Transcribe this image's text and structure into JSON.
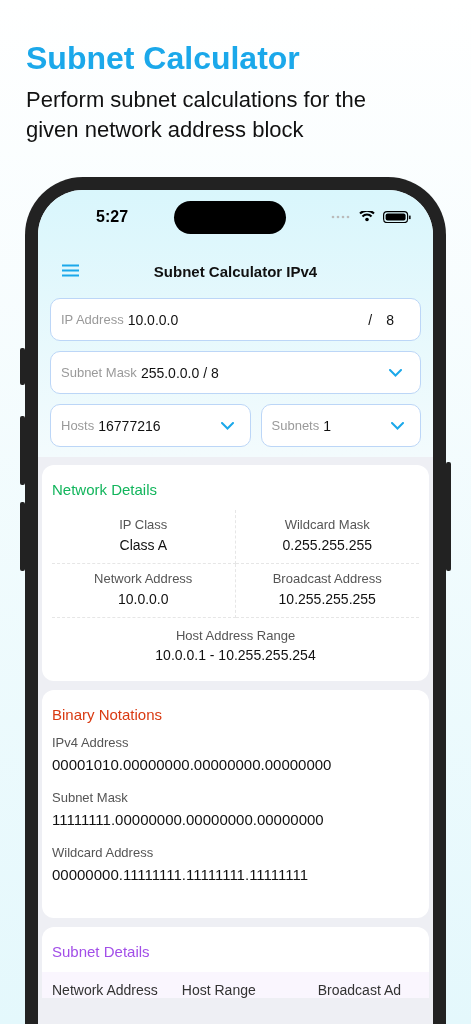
{
  "header": {
    "title": "Subnet Calculator",
    "subtitle": "Perform subnet calculations for the given network address block"
  },
  "status_bar": {
    "time": "5:27"
  },
  "nav": {
    "title": "Subnet Calculator IPv4"
  },
  "ip_field": {
    "label": "IP Address",
    "value": "10.0.0.0",
    "separator": "/",
    "prefix": "8"
  },
  "selects": [
    {
      "label": "Subnet Mask",
      "value": "255.0.0.0 / 8",
      "kind": "full"
    },
    {
      "label": "Hosts",
      "value": "16777216",
      "kind": "half"
    },
    {
      "label": "Subnets",
      "value": "1",
      "kind": "half"
    }
  ],
  "network_details": {
    "title": "Network Details",
    "items": [
      {
        "label": "IP Class",
        "value": "Class A"
      },
      {
        "label": "Wildcard Mask",
        "value": "0.255.255.255"
      },
      {
        "label": "Network Address",
        "value": "10.0.0.0"
      },
      {
        "label": "Broadcast Address",
        "value": "10.255.255.255"
      }
    ],
    "range": {
      "label": "Host Address Range",
      "value": "10.0.0.1 - 10.255.255.254"
    }
  },
  "binary_notations": {
    "title": "Binary Notations",
    "items": [
      {
        "label": "IPv4 Address",
        "value": "00001010.00000000.00000000.00000000"
      },
      {
        "label": "Subnet Mask",
        "value": "11111111.00000000.00000000.00000000"
      },
      {
        "label": "Wildcard Address",
        "value": "00000000.11111111.11111111.11111111"
      }
    ]
  },
  "subnet_details": {
    "title": "Subnet Details",
    "columns": [
      "Network Address",
      "Host Range",
      "Broadcast Ad"
    ]
  }
}
